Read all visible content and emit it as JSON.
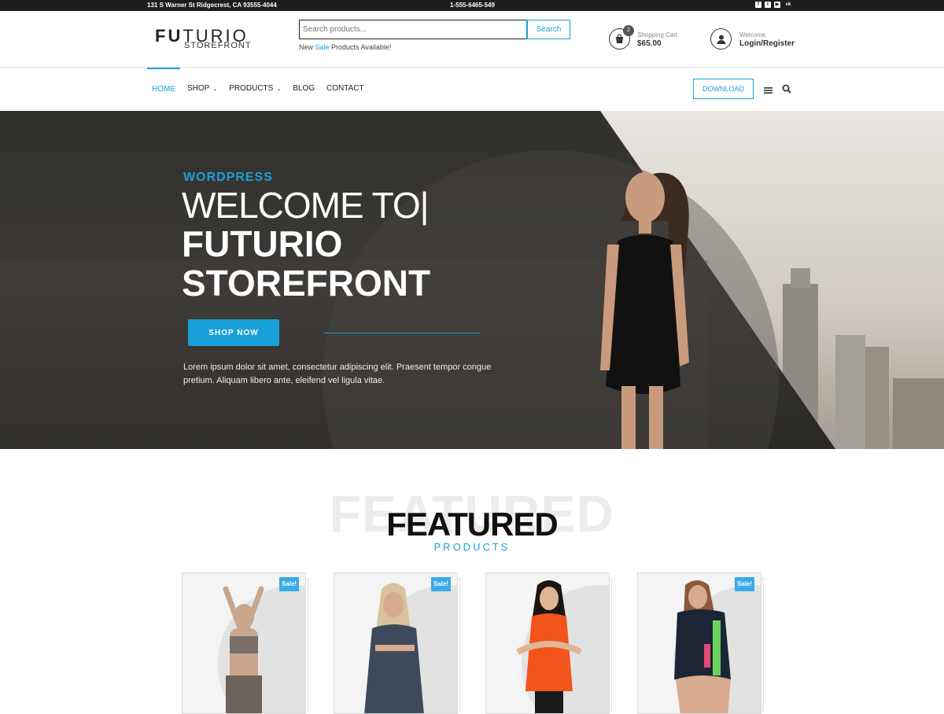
{
  "topbar": {
    "address": "131 S Warner St Ridgecrest, CA 93555-4044",
    "phone": "1-555-6465-549",
    "socials": [
      "facebook-icon",
      "twitter-icon",
      "youtube-icon",
      "vk-icon"
    ]
  },
  "header": {
    "logo_bold": "FU",
    "logo_rest": "TURIO",
    "logo_sub": "STOREFRONT",
    "search": {
      "placeholder": "Search products...",
      "button": "Search"
    },
    "sale_note": {
      "prefix": "New ",
      "highlight": "Sale",
      "suffix": " Products Available!"
    },
    "cart": {
      "count": "2",
      "label": "Shopping Cart",
      "amount": "$65.00"
    },
    "account": {
      "label": "Welcome",
      "action": "Login/Register"
    }
  },
  "nav": {
    "items": [
      {
        "label": "HOME",
        "active": true
      },
      {
        "label": "SHOP",
        "dropdown": true
      },
      {
        "label": "PRODUCTS",
        "dropdown": true
      },
      {
        "label": "BLOG"
      },
      {
        "label": "CONTACT"
      }
    ],
    "download": "DOWNLOAD"
  },
  "hero": {
    "kicker": "WORDPRESS",
    "welcome": "WELCOME TO|",
    "title_line1": "FUTURIO",
    "title_line2": "STOREFRONT",
    "button": "SHOP NOW",
    "description": "Lorem ipsum dolor sit amet, consectetur adipiscing elit. Praesent tempor congue pretium. Aliquam libero ante, eleifend vel ligula vitae."
  },
  "featured": {
    "background_word": "FEATURED",
    "title": "FEATURED",
    "subtitle": "PRODUCTS",
    "products": [
      {
        "badge": "Sale!",
        "outfit": "#7a6f68"
      },
      {
        "badge": "Sale!",
        "outfit": "#3e4a5c"
      },
      {
        "badge": "",
        "outfit": "#f2541b"
      },
      {
        "badge": "Sale!",
        "outfit": "#1c2436"
      }
    ]
  },
  "colors": {
    "accent": "#1aa0d9",
    "topbar": "#1d1d1d",
    "hero_dark": "#2b2a28"
  }
}
